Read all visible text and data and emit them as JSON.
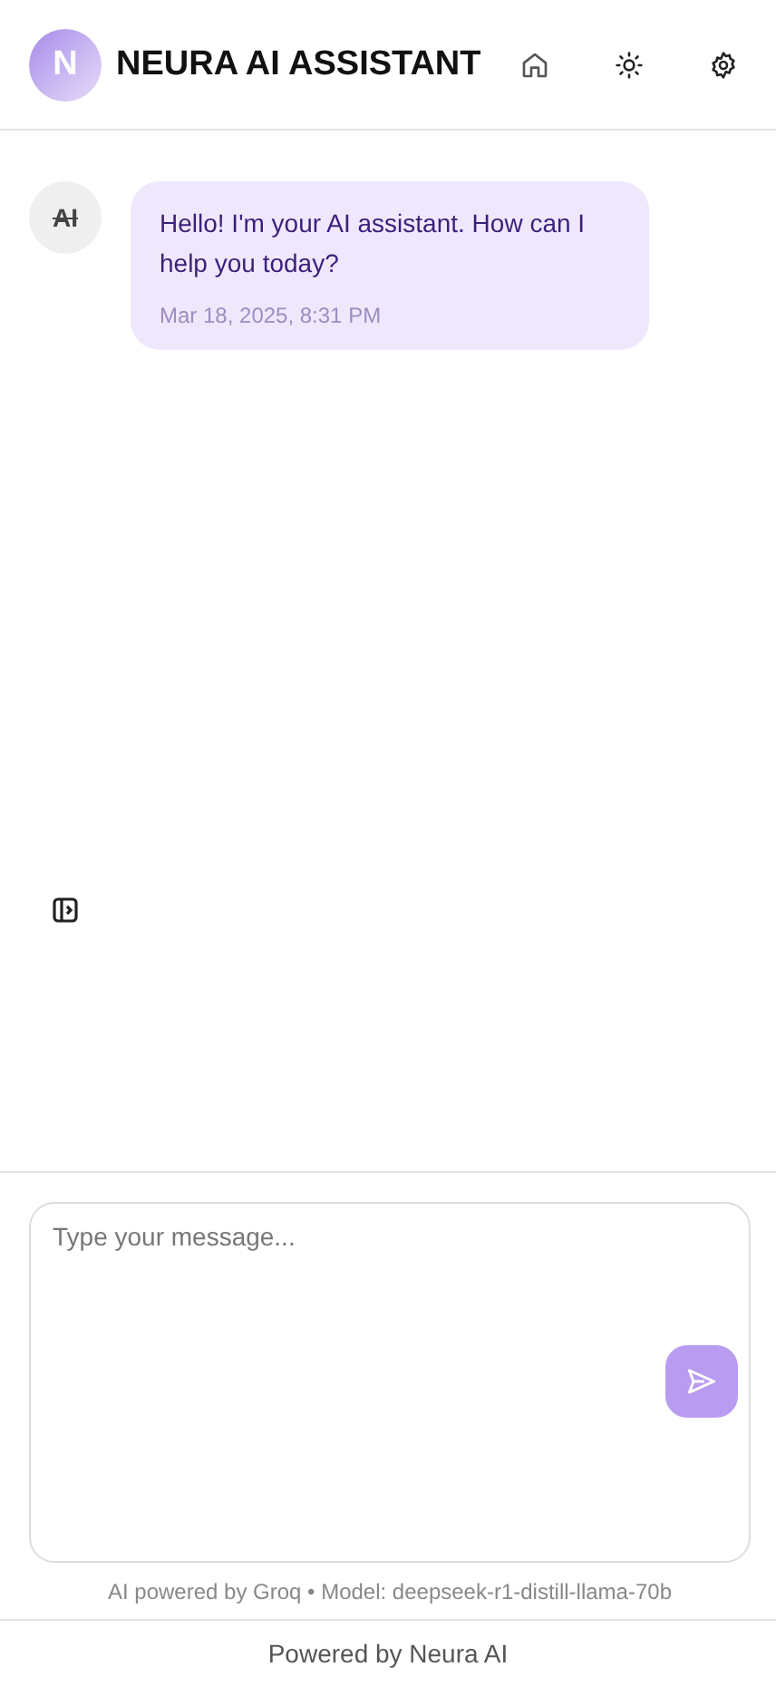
{
  "header": {
    "logo_letter": "N",
    "title": "NEURA AI ASSISTANT"
  },
  "messages": [
    {
      "kind": "assistant",
      "avatar": "AI",
      "text": "Hello! I'm your AI assistant. How can I help you today?",
      "time": "Mar 18, 2025, 8:31 PM"
    }
  ],
  "composer": {
    "placeholder": "Type your message..."
  },
  "model_note": "AI powered by Groq • Model: deepseek-r1-distill-llama-70b",
  "footer": "Powered by Neura AI"
}
